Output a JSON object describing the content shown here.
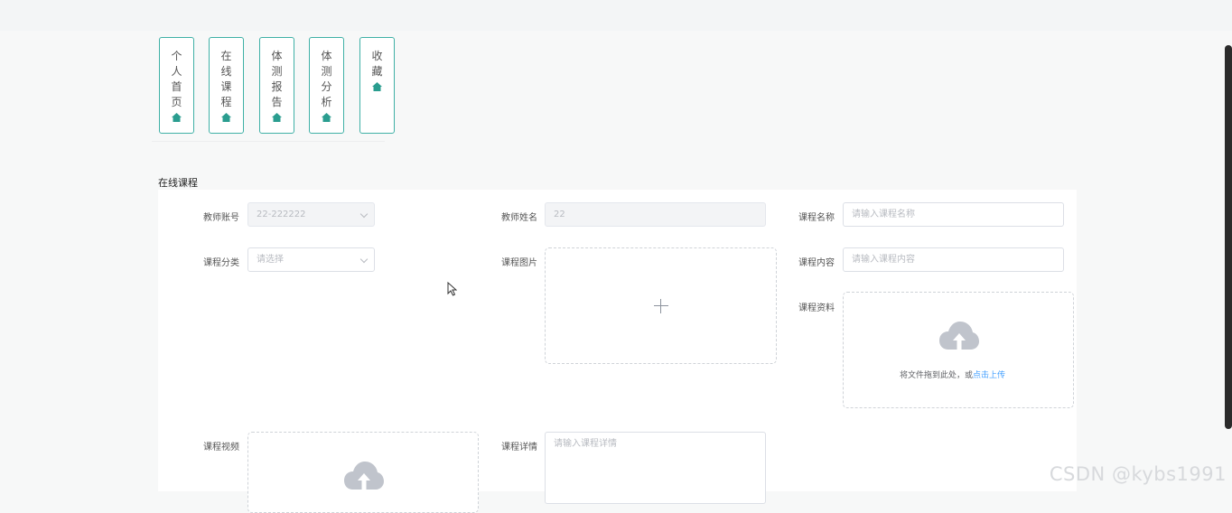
{
  "nav": {
    "items": [
      {
        "label": "个人首页"
      },
      {
        "label": "在线课程"
      },
      {
        "label": "体测报告"
      },
      {
        "label": "体测分析"
      },
      {
        "label": "收藏"
      }
    ],
    "icon": "home-icon",
    "accent_color": "#3fb0a6"
  },
  "section": {
    "title": "在线课程"
  },
  "form": {
    "teacher_account": {
      "label": "教师账号",
      "value": "22-222222"
    },
    "teacher_name": {
      "label": "教师姓名",
      "value": "22"
    },
    "course_name": {
      "label": "课程名称",
      "placeholder": "请输入课程名称"
    },
    "course_category": {
      "label": "课程分类",
      "placeholder": "请选择"
    },
    "course_image": {
      "label": "课程图片"
    },
    "course_content": {
      "label": "课程内容",
      "placeholder": "请输入课程内容"
    },
    "course_material": {
      "label": "课程资料",
      "upload_text": "将文件拖到此处，或",
      "upload_link": "点击上传"
    },
    "course_video": {
      "label": "课程视频"
    },
    "course_detail": {
      "label": "课程详情",
      "placeholder": "请输入课程详情"
    }
  },
  "watermark": "CSDN @kybs1991"
}
